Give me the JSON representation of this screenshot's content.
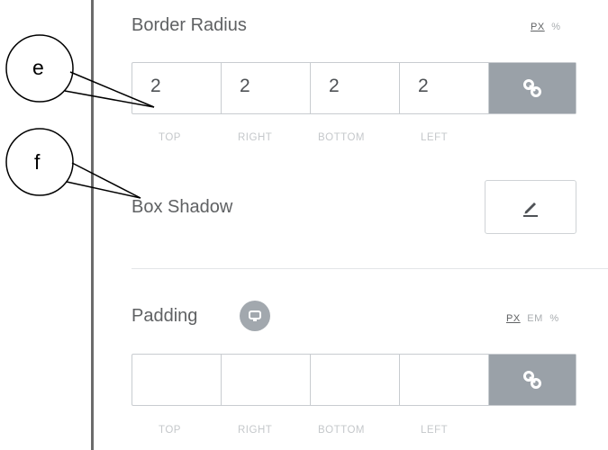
{
  "border_radius": {
    "label": "Border Radius",
    "units": [
      "PX",
      "%"
    ],
    "active_unit": "PX",
    "values": [
      "2",
      "2",
      "2",
      "2"
    ],
    "sides": [
      "TOP",
      "RIGHT",
      "BOTTOM",
      "LEFT"
    ],
    "link_icon": "link-icon"
  },
  "box_shadow": {
    "label": "Box Shadow",
    "edit_icon": "pencil-icon"
  },
  "padding": {
    "label": "Padding",
    "badge_icon": "responsive-icon",
    "units": [
      "PX",
      "EM",
      "%"
    ],
    "active_unit": "PX",
    "values": [
      "",
      "",
      "",
      ""
    ],
    "sides": [
      "TOP",
      "RIGHT",
      "BOTTOM",
      "LEFT"
    ],
    "link_icon": "link-icon"
  },
  "callouts": {
    "e": "e",
    "f": "f"
  },
  "colors": {
    "accent_gray": "#9aa1a8",
    "label_text": "#5f6163",
    "border": "#c8ccd0"
  }
}
